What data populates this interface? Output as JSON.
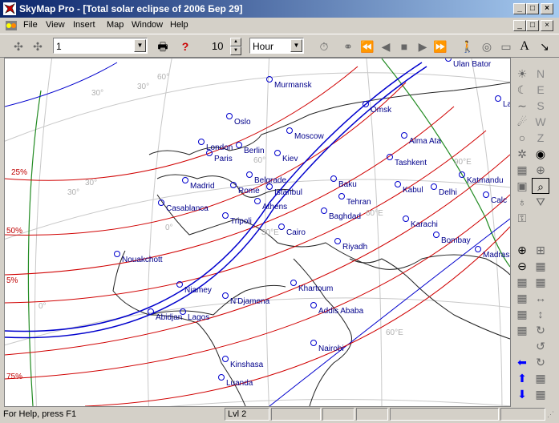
{
  "window": {
    "title": "SkyMap Pro - [Total solar eclipse of 2006 Бер 29]",
    "min": "_",
    "max": "□",
    "close": "×"
  },
  "menu": {
    "items": [
      "File",
      "View",
      "Insert",
      "Map",
      "Window",
      "Help"
    ]
  },
  "toolbar": {
    "scale_value": "1",
    "step_value": "10",
    "unit_value": "Hour"
  },
  "map": {
    "cities": [
      {
        "name": "Murmansk",
        "icon": "city-circle-icon"
      },
      {
        "name": "Oslo"
      },
      {
        "name": "London"
      },
      {
        "name": "Berlin"
      },
      {
        "name": "Paris"
      },
      {
        "name": "Moscow"
      },
      {
        "name": "Omsk"
      },
      {
        "name": "Kiev"
      },
      {
        "name": "Alma Ata"
      },
      {
        "name": "Tashkent"
      },
      {
        "name": "Madrid"
      },
      {
        "name": "Rome"
      },
      {
        "name": "Belgrade"
      },
      {
        "name": "Istanbul"
      },
      {
        "name": "Baku"
      },
      {
        "name": "Kabul"
      },
      {
        "name": "Delhi"
      },
      {
        "name": "Katmandu"
      },
      {
        "name": "Calc"
      },
      {
        "name": "Casablanca"
      },
      {
        "name": "Athens"
      },
      {
        "name": "Tehran"
      },
      {
        "name": "Tripoli"
      },
      {
        "name": "Baghdad"
      },
      {
        "name": "Cairo"
      },
      {
        "name": "Karachi"
      },
      {
        "name": "Bombay"
      },
      {
        "name": "Riyadh"
      },
      {
        "name": "Nouakchott"
      },
      {
        "name": "Madras"
      },
      {
        "name": "Khartoum"
      },
      {
        "name": "Niamey"
      },
      {
        "name": "N'Djamena"
      },
      {
        "name": "Abidjan"
      },
      {
        "name": "Lagos"
      },
      {
        "name": "Addis Ababa"
      },
      {
        "name": "Nairobi"
      },
      {
        "name": "Kinshasa"
      },
      {
        "name": "Luanda"
      },
      {
        "name": "Ulan Bator"
      },
      {
        "name": "La"
      }
    ],
    "percent_labels": [
      "25%",
      "50%",
      "5%",
      "75%"
    ],
    "grid_labels": [
      "60°",
      "30°",
      "90°E",
      "30°",
      "0°",
      "30°E",
      "60°E",
      "0°",
      "30°",
      "60°E",
      "30°",
      "60°"
    ]
  },
  "status": {
    "help": "For Help, press F1",
    "level": "Lvl 2"
  }
}
